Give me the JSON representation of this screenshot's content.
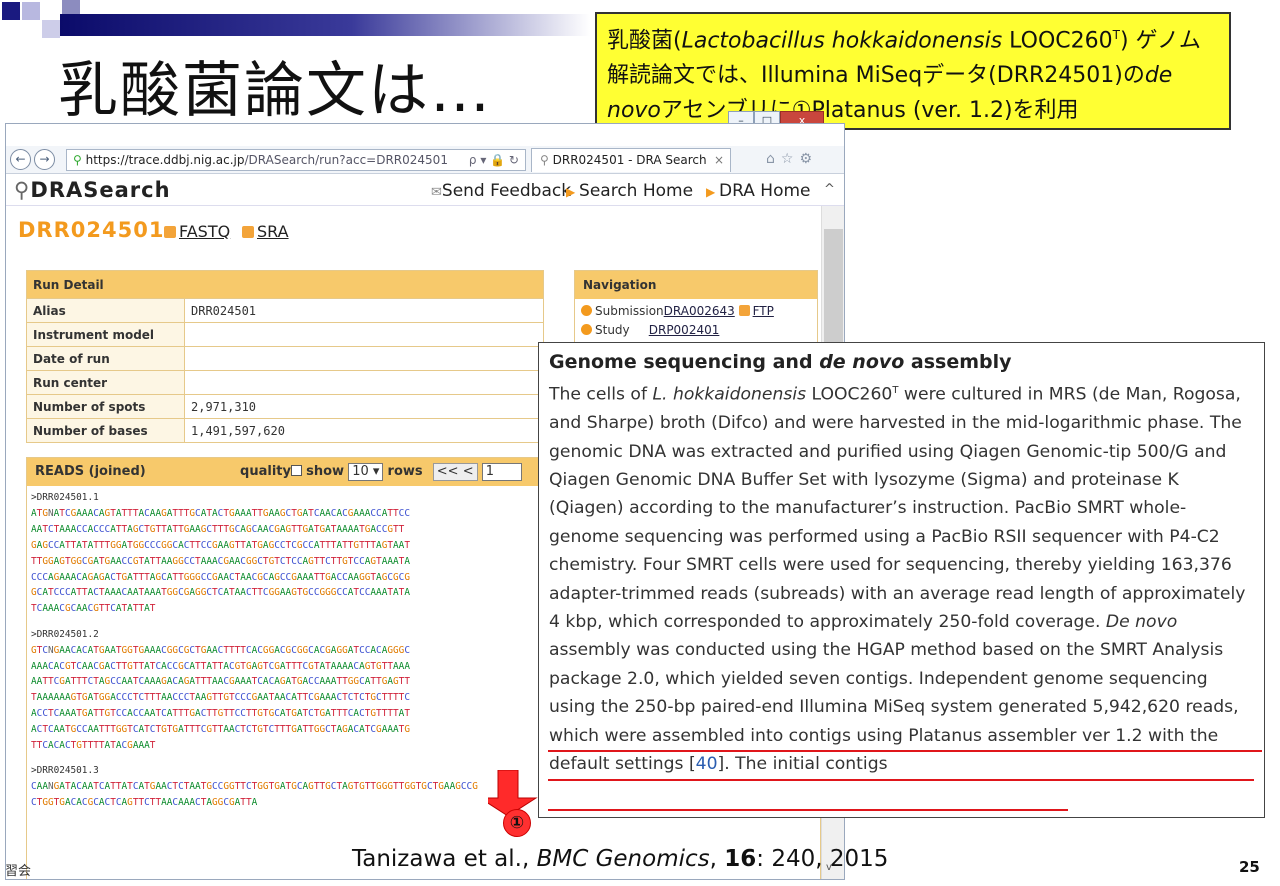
{
  "slide": {
    "title": "乳酸菌論文は…",
    "note_pre": "乳酸菌(",
    "note_species": "Lactobacillus hokkaidonensis",
    "note_mid": " LOOC260",
    "note_sup": "T",
    "note_post": ") ゲノム解読論文では、Illumina MiSeqデータ(DRR24501)の",
    "note_denovo": "de novo",
    "note_end": "アセンブリに①Platanus (ver. 1.2)を利用",
    "citation_pre": "Tanizawa et al., ",
    "citation_journal": "BMC Genomics",
    "citation_sep": ", ",
    "citation_vol": "16",
    "citation_post": ": 240, 2015",
    "page_number": "25",
    "footer_left": "習会",
    "marker": "①"
  },
  "browser": {
    "url_prefix": "https://",
    "url_host": "trace.ddbj.nig.ac.jp",
    "url_path": "/DRASearch/run?acc=DRR024501",
    "url_icons": "ρ ▾ 🔒 ↻",
    "tab_title": "DRR024501 - DRA Search",
    "tab_close": "×",
    "toolbar_icons": "⌂☆⚙",
    "back": "←",
    "forward": "→",
    "win_min": "–",
    "win_max": "□",
    "win_close": "x"
  },
  "site": {
    "logo": "DRASearch",
    "send_feedback": "Send Feedback",
    "search_home": "Search Home",
    "dra_home": "DRA Home",
    "run_id": "DRR024501",
    "fastq": "FASTQ",
    "sra": "SRA"
  },
  "run_detail": {
    "header": "Run Detail",
    "rows": [
      {
        "key": "Alias",
        "value": "DRR024501"
      },
      {
        "key": "Instrument model",
        "value": ""
      },
      {
        "key": "Date of run",
        "value": ""
      },
      {
        "key": "Run center",
        "value": ""
      },
      {
        "key": "Number of spots",
        "value": "2,971,310"
      },
      {
        "key": "Number of bases",
        "value": "1,491,597,620"
      }
    ]
  },
  "navigation": {
    "header": "Navigation",
    "submission_label": "Submission",
    "submission_link": "DRA002643",
    "ftp": "FTP",
    "study_label": "Study",
    "study_link": "DRP002401"
  },
  "reads": {
    "header": "READS (joined)",
    "quality": "quality",
    "show": "show",
    "rows_value": "10",
    "rows": "rows",
    "pager": "<<  <",
    "page": "1",
    "entries": [
      {
        "id": ">DRR024501.1",
        "lines": [
          "ATGNATCGAAACAGTATTTACAAGATTTGCATACTGAAATTGAAGCTGATCAACACGAAACCATTCC",
          "AATCTAAACCACCCATTAGCTGTTATTGAAGCTTTGCAGCAACGAGTTGATGATAAAATGACCGTT",
          "GAGCCATTATATTTGGATGGCCCGGCACTTCCGAAGTTATGAGCCTCGCCATTTATTGTTTAGTAAT",
          "TTGGAGTGGCGATGAACCGTATTAAGGCCTAAACGAACGGCTGTCTCCAGTTCTTGTCCAGTAAATA",
          "CCCAGAAACAGAGACTGATTTAGCATTGGGCCGAACTAACGCAGCCGAAATTGACCAAGGTAGCGCG",
          "GCATCCCATTACTAAACAATAAATGGCGAGGCTCATAACTTCGGAAGTGCCGGGCCATCCAAATATA",
          "TCAAACGCAACGTTCATATTAT"
        ]
      },
      {
        "id": ">DRR024501.2",
        "lines": [
          "GTCNGAACACATGAATGGTGAAACGGCGCTGAACTTTTCACGGACGCGGCACGAGGATCCACAGGGC",
          "AAACACGTCAACGACTTGTTATCACCGCATTATTACGTGAGTCGATTTCGTATAAAACAGTGTTAAA",
          "AATTCGATTTCTAGCCAATCAAAGACAGATTTAACGAAATCACAGATGACCAAATTGGCATTGAGTT",
          "TAAAAAAGTGATGGACCCTCTTTAACCCTAAGTTGTCCCGAATAACATTCGAAACTCTCTGCTTTTC",
          "ACCTCAAATGATTGTCCACCAATCATTTGACTTGTTCCTTGTGCATGATCTGATTTCACTGTTTTAT",
          "ACTCAATGCCAATTTGGTCATCTGTGATTTCGTTAACTCTGTCTTTGATTGGCTAGACATCGAAATG",
          "TTCACACTGTTTTATACGAAAT"
        ]
      },
      {
        "id": ">DRR024501.3",
        "lines": [
          "CAANGATACAATCATTATCATGAACTCTAATGCCGGTTCTGGTGATGCAGTTGCTAGTGTTGGGTTGGTGCTGAAGCCG",
          "CTGGTGACACGCACTCAGTTCTTAACAAACTAGGCGATTA"
        ]
      }
    ]
  },
  "excerpt": {
    "title_pre": "Genome sequencing and ",
    "title_it": "de novo",
    "title_post": " assembly",
    "s1": "The cells of ",
    "s1_it": "L. hokkaidonensis",
    "s1_b": " LOOC260",
    "s1_sup": "T",
    "s1_c": " were cultured in MRS (de Man, Rogosa, and Sharpe) broth (Difco) and were harvested in the mid-logarithmic phase. The genomic DNA was extracted and purified using Qiagen Genomic-tip 500/G and Qiagen Genomic DNA Buffer Set with lysozyme (Sigma) and proteinase K (Qiagen) according to the manufacturer’s instruction. PacBio SMRT whole-genome sequencing was performed using a PacBio RSII sequencer with P4-C2 chemistry. Four SMRT cells were used for sequencing, thereby yielding 163,376 adapter-trimmed reads (subreads) with an average read length of approximately 4 kbp, which corresponded to approximately 250-fold coverage. ",
    "s2_it": "De novo",
    "s2": " assembly was conducted using the HGAP method based on the SMRT Analysis package 2.0, which yielded seven contigs. ",
    "s3": "Independent genome sequencing using the 250-bp paired-end Illumina MiSeq system generated 5,942,620 reads, which were assembled into contigs using Platanus assembler ver 1.2 with the default settings [",
    "ref": "40",
    "s4": "]. The initial contigs"
  }
}
